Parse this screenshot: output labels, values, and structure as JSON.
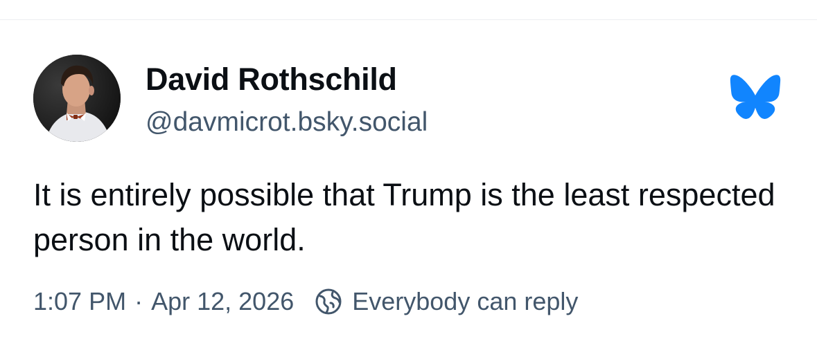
{
  "post": {
    "author_name": "David Rothschild",
    "author_handle": "@davmicrot.bsky.social",
    "text": "It is entirely possible that Trump is the least respected person in the world.",
    "time": "1:07 PM",
    "separator": "·",
    "date": "Apr 12, 2026",
    "reply_setting": "Everybody can reply"
  },
  "icons": {
    "logo": "bluesky-butterfly-icon",
    "reply_setting": "globe-icon"
  },
  "colors": {
    "brand": "#1185fe",
    "text": "#0b0f14",
    "secondary_text": "#42566b"
  }
}
